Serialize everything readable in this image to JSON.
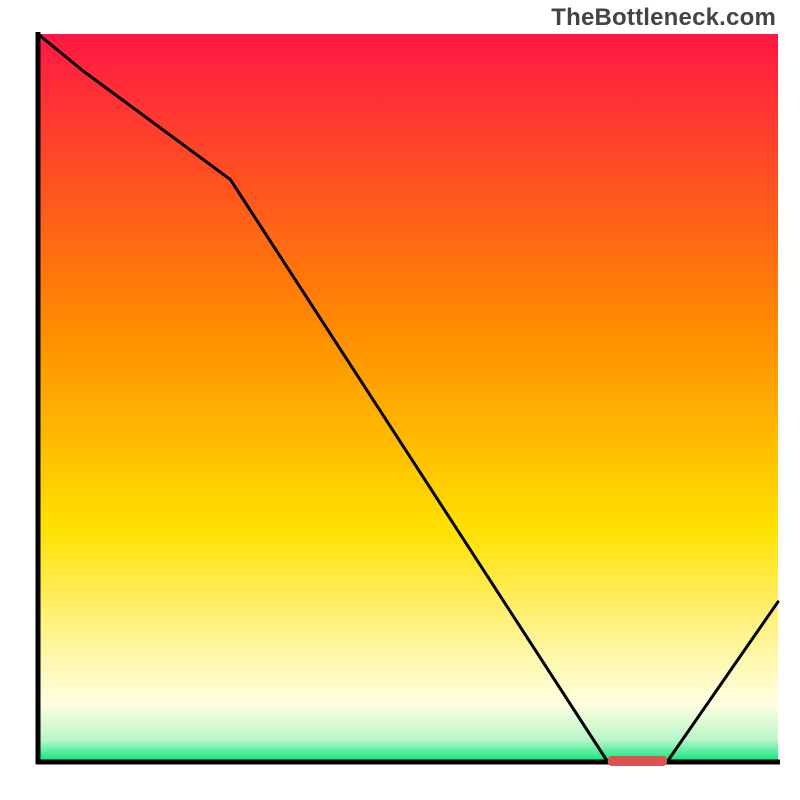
{
  "watermark": "TheBottleneck.com",
  "chart_data": {
    "type": "line",
    "title": "",
    "xlabel": "",
    "ylabel": "",
    "xlim": [
      0,
      100
    ],
    "ylim": [
      0,
      100
    ],
    "x": [
      0,
      6,
      26,
      77,
      85,
      100
    ],
    "values": [
      100,
      95,
      80,
      0,
      0,
      22
    ],
    "marker": {
      "x_start": 77,
      "x_end": 85,
      "y": 0,
      "color": "#d9534f"
    },
    "gradient_stops": [
      {
        "offset": 0.0,
        "color": "#ff1744"
      },
      {
        "offset": 0.4,
        "color": "#ff8a00"
      },
      {
        "offset": 0.68,
        "color": "#ffe100"
      },
      {
        "offset": 0.84,
        "color": "#fff59d"
      },
      {
        "offset": 0.92,
        "color": "#ffffe0"
      },
      {
        "offset": 0.97,
        "color": "#b9f6ca"
      },
      {
        "offset": 1.0,
        "color": "#00e676"
      }
    ],
    "axis_color": "#000000",
    "line_color": "#000000",
    "line_width": 3
  }
}
